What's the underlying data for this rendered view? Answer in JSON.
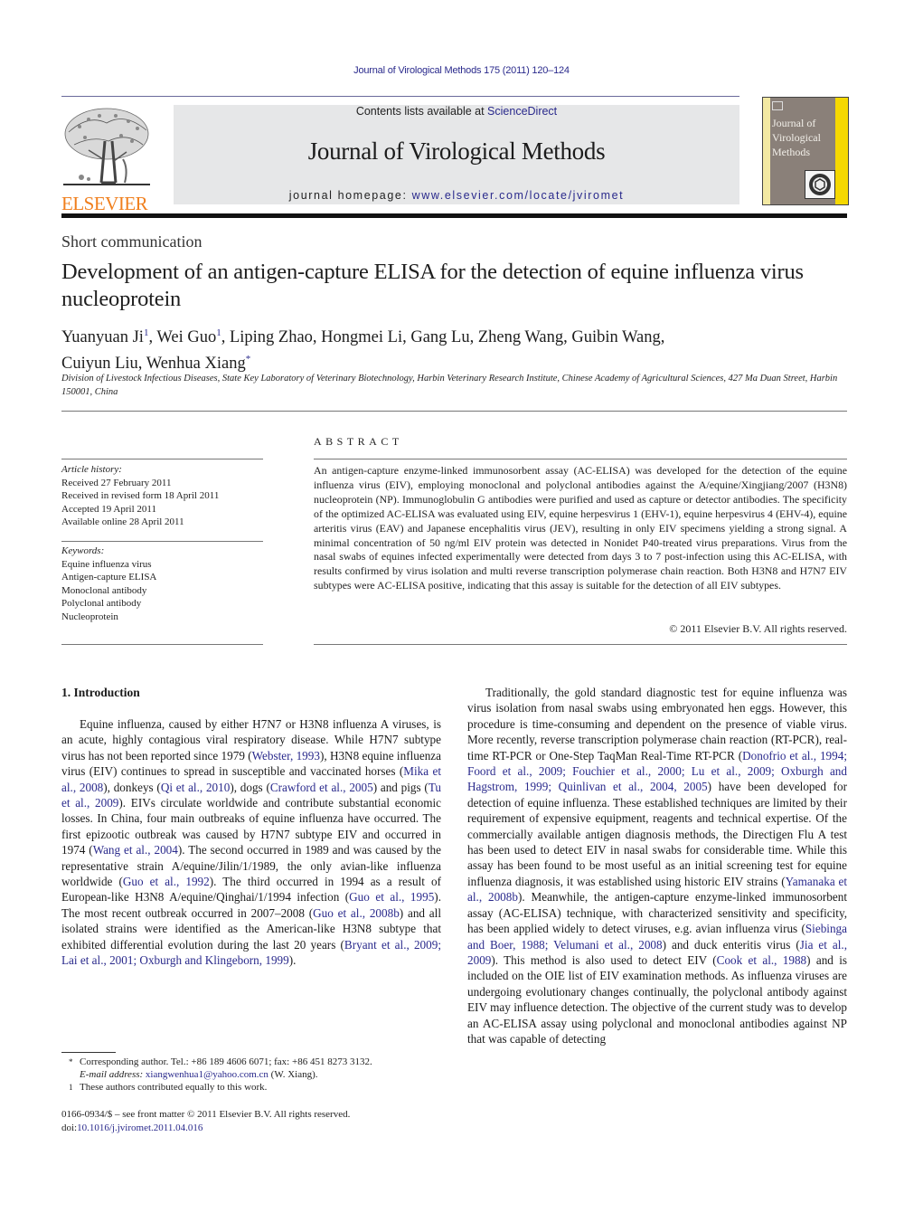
{
  "header": {
    "running_head": "Journal of Virological Methods 175 (2011) 120–124",
    "contents_prefix": "Contents lists available at ",
    "contents_link": "ScienceDirect",
    "journal_title": "Journal of Virological Methods",
    "homepage_prefix": "journal homepage: ",
    "homepage_link": "www.elsevier.com/locate/jviromet",
    "publisher_logo_text": "ELSEVIER",
    "cover_title_lines": [
      "Journal of",
      "Virological",
      "Methods"
    ],
    "colors": {
      "link": "#2a2a8c",
      "elsevier_orange": "#f07f1d",
      "banner_bg": "#e6e7e8",
      "cover_bg": "#8a8079",
      "cover_stripe": "#f5d800"
    }
  },
  "article": {
    "section_type": "Short communication",
    "title": "Development of an antigen-capture ELISA for the detection of equine influenza virus nucleoprotein",
    "authors_line1": [
      {
        "name": "Yuanyuan Ji",
        "mark": "1"
      },
      {
        "name": "Wei Guo",
        "mark": "1"
      },
      {
        "name": "Liping Zhao",
        "mark": ""
      },
      {
        "name": "Hongmei Li",
        "mark": ""
      },
      {
        "name": "Gang Lu",
        "mark": ""
      },
      {
        "name": "Zheng Wang",
        "mark": ""
      },
      {
        "name": "Guibin Wang",
        "mark": ""
      }
    ],
    "authors_line2": [
      {
        "name": "Cuiyun Liu",
        "mark": ""
      },
      {
        "name": "Wenhua Xiang",
        "mark": "*"
      }
    ],
    "affiliation": "Division of Livestock Infectious Diseases, State Key Laboratory of Veterinary Biotechnology, Harbin Veterinary Research Institute, Chinese Academy of Agricultural Sciences, 427 Ma Duan Street, Harbin 150001, China"
  },
  "article_info": {
    "history_heading": "Article history:",
    "history": [
      "Received 27 February 2011",
      "Received in revised form 18 April 2011",
      "Accepted 19 April 2011",
      "Available online 28 April 2011"
    ],
    "keywords_heading": "Keywords:",
    "keywords": [
      "Equine influenza virus",
      "Antigen-capture ELISA",
      "Monoclonal antibody",
      "Polyclonal antibody",
      "Nucleoprotein"
    ]
  },
  "abstract": {
    "label": "ABSTRACT",
    "text": "An antigen-capture enzyme-linked immunosorbent assay (AC-ELISA) was developed for the detection of the equine influenza virus (EIV), employing monoclonal and polyclonal antibodies against the A/equine/Xingjiang/2007 (H3N8) nucleoprotein (NP). Immunoglobulin G antibodies were purified and used as capture or detector antibodies. The specificity of the optimized AC-ELISA was evaluated using EIV, equine herpesvirus 1 (EHV-1), equine herpesvirus 4 (EHV-4), equine arteritis virus (EAV) and Japanese encephalitis virus (JEV), resulting in only EIV specimens yielding a strong signal. A minimal concentration of 50 ng/ml EIV protein was detected in Nonidet P40-treated virus preparations. Virus from the nasal swabs of equines infected experimentally were detected from days 3 to 7 post-infection using this AC-ELISA, with results confirmed by virus isolation and multi reverse transcription polymerase chain reaction. Both H3N8 and H7N7 EIV subtypes were AC-ELISA positive, indicating that this assay is suitable for the detection of all EIV subtypes.",
    "copyright": "© 2011 Elsevier B.V. All rights reserved."
  },
  "introduction": {
    "heading": "1.  Introduction",
    "left_paragraph": [
      {
        "t": "Equine influenza, caused by either H7N7 or H3N8 influenza A viruses, is an acute, highly contagious viral respiratory disease. While H7N7 subtype virus has not been reported since 1979 ("
      },
      {
        "l": "Webster, 1993"
      },
      {
        "t": "), H3N8 equine influenza virus (EIV) continues to spread in susceptible and vaccinated horses ("
      },
      {
        "l": "Mika et al., 2008"
      },
      {
        "t": "), donkeys ("
      },
      {
        "l": "Qi et al., 2010"
      },
      {
        "t": "), dogs ("
      },
      {
        "l": "Crawford et al., 2005"
      },
      {
        "t": ") and pigs ("
      },
      {
        "l": "Tu et al., 2009"
      },
      {
        "t": "). EIVs circulate worldwide and contribute substantial economic losses. In China, four main outbreaks of equine influenza have occurred. The first epizootic outbreak was caused by H7N7 subtype EIV and occurred in 1974 ("
      },
      {
        "l": "Wang et al., 2004"
      },
      {
        "t": "). The second occurred in 1989 and was caused by the representative strain A/equine/Jilin/1/1989, the only avian-like influenza worldwide ("
      },
      {
        "l": "Guo et al., 1992"
      },
      {
        "t": "). The third occurred in 1994 as a result of European-like H3N8 A/equine/Qinghai/1/1994 infection ("
      },
      {
        "l": "Guo et al., 1995"
      },
      {
        "t": "). The most recent outbreak occurred in 2007–2008 ("
      },
      {
        "l": "Guo et al., 2008b"
      },
      {
        "t": ") and all isolated strains were identified as the American-like H3N8 subtype that exhibited differential evolution during the last 20 years ("
      },
      {
        "l": "Bryant et al., 2009; Lai et al., 2001; Oxburgh and Klingeborn, 1999"
      },
      {
        "t": ")."
      }
    ],
    "right_paragraph": [
      {
        "t": "Traditionally, the gold standard diagnostic test for equine influenza was virus isolation from nasal swabs using embryonated hen eggs. However, this procedure is time-consuming and dependent on the presence of viable virus. More recently, reverse transcription polymerase chain reaction (RT-PCR), real-time RT-PCR or One-Step TaqMan Real-Time RT-PCR ("
      },
      {
        "l": "Donofrio et al., 1994; Foord et al., 2009; Fouchier et al., 2000; Lu et al., 2009; Oxburgh and Hagstrom, 1999; Quinlivan et al., 2004, 2005"
      },
      {
        "t": ") have been developed for detection of equine influenza. These established techniques are limited by their requirement of expensive equipment, reagents and technical expertise. Of the commercially available antigen diagnosis methods, the Directigen Flu A test has been used to detect EIV in nasal swabs for considerable time. While this assay has been found to be most useful as an initial screening test for equine influenza diagnosis, it was established using historic EIV strains ("
      },
      {
        "l": "Yamanaka et al., 2008b"
      },
      {
        "t": "). Meanwhile, the antigen-capture enzyme-linked immunosorbent assay (AC-ELISA) technique, with characterized sensitivity and specificity, has been applied widely to detect viruses, e.g. avian influenza virus ("
      },
      {
        "l": "Siebinga and Boer, 1988; Velumani et al., 2008"
      },
      {
        "t": ") and duck enteritis virus ("
      },
      {
        "l": "Jia et al., 2009"
      },
      {
        "t": "). This method is also used to detect EIV ("
      },
      {
        "l": "Cook et al., 1988"
      },
      {
        "t": ") and is included on the OIE list of EIV examination methods. As influenza viruses are undergoing evolutionary changes continually, the polyclonal antibody against EIV may influence detection. The objective of the current study was to develop an AC-ELISA assay using polyclonal and monoclonal antibodies against NP that was capable of detecting"
      }
    ]
  },
  "footnotes": {
    "corresponding_mark": "*",
    "corresponding": "Corresponding author. Tel.: +86 189 4606 6071; fax: +86 451 8273 3132.",
    "email_label": "E-mail address: ",
    "email": "xiangwenhua1@yahoo.com.cn",
    "email_suffix": " (W. Xiang).",
    "equal_mark": "1",
    "equal": "These authors contributed equally to this work."
  },
  "front_matter": {
    "issn_line": "0166-0934/$ – see front matter © 2011 Elsevier B.V. All rights reserved.",
    "doi_prefix": "doi:",
    "doi": "10.1016/j.jviromet.2011.04.016"
  }
}
